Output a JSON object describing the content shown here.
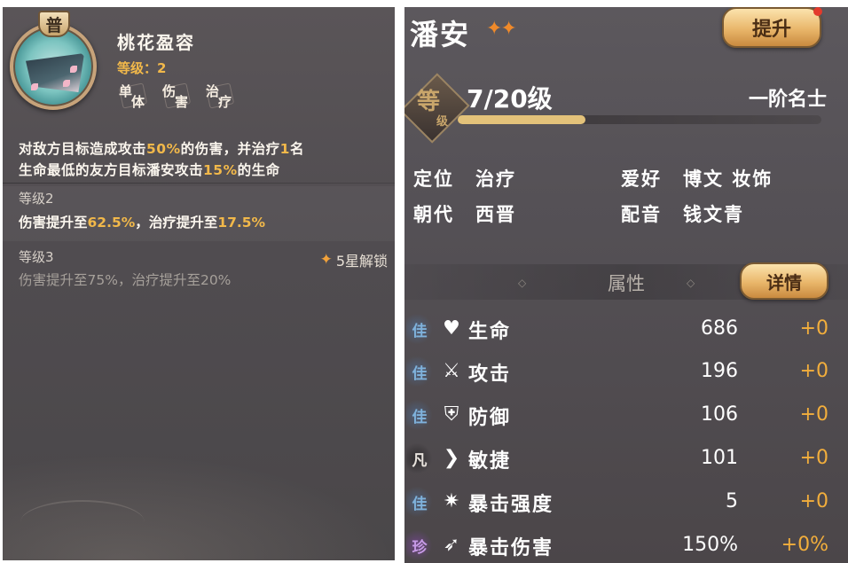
{
  "skill_panel": {
    "badge": "普",
    "name": "桃花盈容",
    "level": "等级：2",
    "tags": [
      {
        "a": "单",
        "b": "体"
      },
      {
        "a": "伤",
        "b": "害"
      },
      {
        "a": "治",
        "b": "疗"
      }
    ],
    "desc_parts": [
      "对敌方目标造成攻击",
      "50%",
      "的伤害，并治疗",
      "1",
      "名",
      "生命最低的友方目标潘安攻击",
      "15%",
      "的生命"
    ],
    "level2_title": "等级2",
    "level2_parts": [
      "伤害提升至",
      "62.5%",
      "，治疗提升至",
      "17.5%"
    ],
    "level3_title": "等级3",
    "level3_text": "伤害提升至75%，治疗提升至20%",
    "unlock_text": "5星解锁"
  },
  "hero_panel": {
    "name": "潘安",
    "stars": "✦✦",
    "upgrade_label": "提升",
    "level_emblem": "等",
    "level_emblem_sub": "级",
    "level": "7/20级",
    "level_progress": 0.35,
    "rank": "一阶名士",
    "info": {
      "role_label": "定位",
      "role_value": "治疗",
      "hobby_label": "爱好",
      "hobby_value": "博文 妆饰",
      "dynasty_label": "朝代",
      "dynasty_value": "西晋",
      "voice_label": "配音",
      "voice_value": "钱文青"
    },
    "section_title": "属性",
    "detail_label": "详情",
    "attributes": [
      {
        "grade": "佳",
        "icon": "heart-icon",
        "glyph": "♥",
        "name": "生命",
        "value": "686",
        "bonus": "+0"
      },
      {
        "grade": "佳",
        "icon": "sword-icon",
        "glyph": "⚔",
        "name": "攻击",
        "value": "196",
        "bonus": "+0"
      },
      {
        "grade": "佳",
        "icon": "shield-icon",
        "glyph": "⛨",
        "name": "防御",
        "value": "106",
        "bonus": "+0"
      },
      {
        "grade": "凡",
        "icon": "agility-icon",
        "glyph": "❯",
        "name": "敏捷",
        "value": "101",
        "bonus": "+0"
      },
      {
        "grade": "佳",
        "icon": "crit-burst-icon",
        "glyph": "✷",
        "name": "暴击强度",
        "value": "5",
        "bonus": "+0"
      },
      {
        "grade": "珍",
        "icon": "crit-damage-icon",
        "glyph": "➶",
        "name": "暴击伤害",
        "value": "150%",
        "bonus": "+0%"
      }
    ]
  }
}
